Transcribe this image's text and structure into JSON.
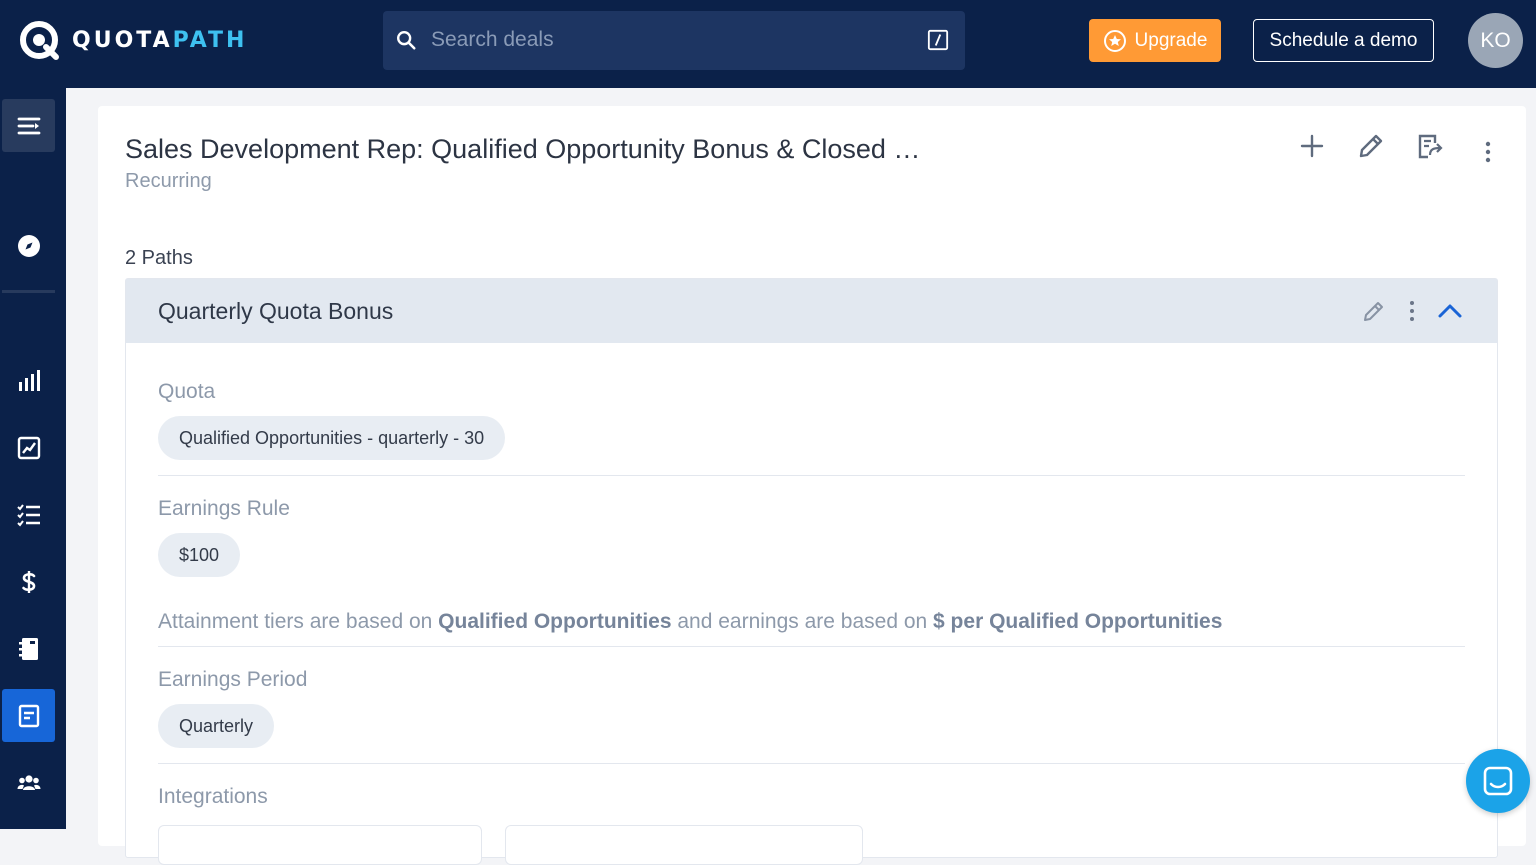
{
  "brand": {
    "name_part1": "QUOTA",
    "name_part2": "PATH",
    "accent_color": "#3ec1f0",
    "nav_bg": "#0b2149"
  },
  "search": {
    "placeholder": "Search deals",
    "icon": "search-icon",
    "shortcut_icon": "slash-key-icon"
  },
  "header": {
    "upgrade_label": "Upgrade",
    "demo_label": "Schedule a demo",
    "avatar_initials": "KO"
  },
  "sidebar": {
    "items": [
      {
        "name": "menu-toggle",
        "icon": "collapse-menu-icon"
      },
      {
        "name": "compass",
        "icon": "compass-icon"
      },
      {
        "name": "analytics",
        "icon": "bar-chart-icon"
      },
      {
        "name": "reports",
        "icon": "chart-line-icon"
      },
      {
        "name": "tasks",
        "icon": "checklist-icon"
      },
      {
        "name": "earnings",
        "icon": "dollar-icon"
      },
      {
        "name": "ledger",
        "icon": "ledger-icon"
      },
      {
        "name": "plans",
        "icon": "document-icon",
        "active": true
      },
      {
        "name": "team",
        "icon": "users-icon"
      }
    ]
  },
  "plan": {
    "title": "Sales Development Rep: Qualified Opportunity Bonus & Closed …",
    "subtitle": "Recurring",
    "actions": [
      "plus-icon",
      "pencil-icon",
      "export-document-icon",
      "more-vertical-icon"
    ]
  },
  "paths": {
    "count_label": "2 Paths",
    "items": [
      {
        "title": "Quarterly Quota Bonus",
        "sections": {
          "quota": {
            "label": "Quota",
            "value": "Qualified Opportunities - quarterly - 30"
          },
          "earnings_rule": {
            "label": "Earnings Rule",
            "value": "$100"
          },
          "attainment_note": {
            "part1": "Attainment tiers are based on ",
            "bold1": "Qualified Opportunities",
            "part2": " and earnings are based on ",
            "bold2": "$ per Qualified Opportunities"
          },
          "earnings_period": {
            "label": "Earnings Period",
            "value": "Quarterly"
          },
          "integrations": {
            "label": "Integrations"
          }
        }
      }
    ]
  },
  "chat": {
    "icon": "chat-icon",
    "color": "#1ba3e8"
  }
}
